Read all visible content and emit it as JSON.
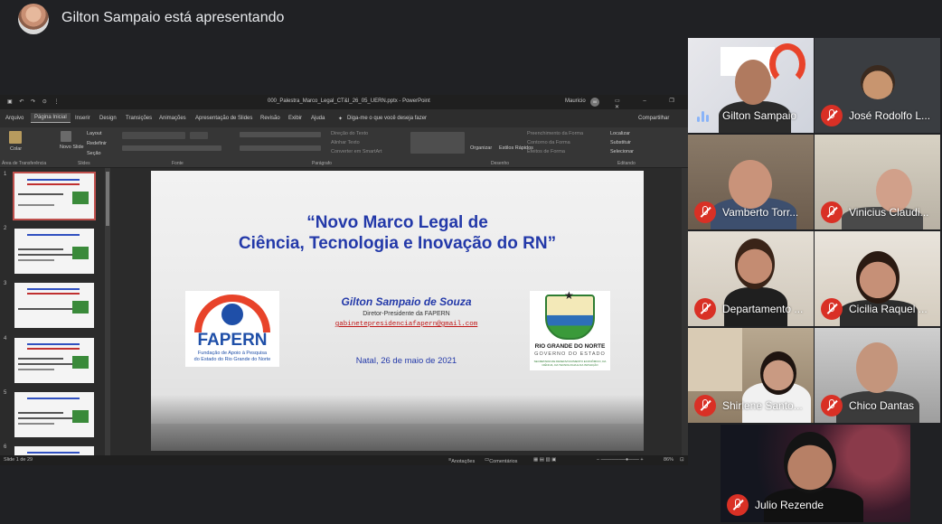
{
  "presenter_banner": {
    "text": "Gilton Sampaio está apresentando"
  },
  "powerpoint": {
    "filename": "000_Palestra_Marco_Legal_CT&I_26_05_UERN.pptx - PowerPoint",
    "user": "Mauricio",
    "user_initials": "M",
    "tabs": [
      "Arquivo",
      "Página Inicial",
      "Inserir",
      "Design",
      "Transições",
      "Animações",
      "Apresentação de Slides",
      "Revisão",
      "Exibir",
      "Ajuda"
    ],
    "active_tab": "Página Inicial",
    "tell_me": "Diga-me o que você deseja fazer",
    "share_label": "Compartilhar",
    "ribbon": {
      "colar": "Colar",
      "novo_slide": "Novo Slide",
      "layout": "Layout",
      "redefinir": "Redefinir",
      "secao": "Seção",
      "direcao_texto": "Direção do Texto",
      "alinhar_texto": "Alinhar Texto",
      "converter_smartart": "Converter em SmartArt",
      "organizar": "Organizar",
      "estilos_rapidos": "Estilos Rápidos",
      "preenchimento": "Preenchimento da Forma",
      "contorno": "Contorno da Forma",
      "efeitos": "Efeitos de Forma",
      "localizar": "Localizar",
      "substituir": "Substituir",
      "selecionar": "Selecionar",
      "groups": [
        "Área de Transferência",
        "Slides",
        "Fonte",
        "Parágrafo",
        "Desenho",
        "Editando"
      ]
    },
    "thumb_numbers": [
      "1",
      "2",
      "3",
      "4",
      "5",
      "6"
    ],
    "status": {
      "slide_count": "Slide 1 de 29",
      "notes": "Anotações",
      "comments": "Comentários",
      "zoom": "86%"
    }
  },
  "slide": {
    "title_line1": "“Novo Marco Legal de",
    "title_line2": "Ciência, Tecnologia e Inovação do RN”",
    "author": "Gilton Sampaio de Souza",
    "role": "Diretor-Presidente da FAPERN",
    "email": "gabinetepresidenciafapern@gmail.com",
    "date": "Natal, 26 de maio de 2021",
    "fapern_logo_text": "FAPERN",
    "fapern_sub1": "Fundação de Apoio à Pesquisa",
    "fapern_sub2": "do Estado do Rio Grande do Norte",
    "rn_logo_text1": "RIO GRANDE DO NORTE",
    "rn_logo_text2": "GOVERNO DO ESTADO",
    "rn_logo_text3": "SECRETARIA DE DESENVOLVIMENTO ECONÔMICO, DA CIÊNCIA, DA TECNOLOGIA E DA INOVAÇÃO"
  },
  "participants": [
    {
      "name": "Gilton Sampaio",
      "muted": false
    },
    {
      "name": "José Rodolfo L...",
      "muted": true
    },
    {
      "name": "Vamberto Torr...",
      "muted": true
    },
    {
      "name": "Vinicius Claudi...",
      "muted": true
    },
    {
      "name": "Departamento ...",
      "muted": true
    },
    {
      "name": "Cicilia Raquel ...",
      "muted": true
    },
    {
      "name": "Shirlene Santo...",
      "muted": true
    },
    {
      "name": "Chico Dantas",
      "muted": true
    },
    {
      "name": "Julio Rezende",
      "muted": true
    }
  ],
  "colors": {
    "background": "#202124",
    "mic_off": "#d93025",
    "slide_blue": "#2339a9",
    "email_red": "#c01818"
  }
}
